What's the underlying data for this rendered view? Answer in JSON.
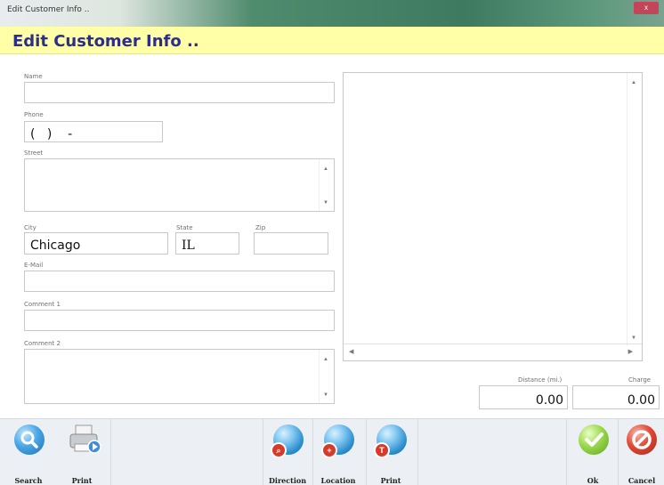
{
  "window": {
    "title": "Edit Customer Info ..",
    "close_label": "x"
  },
  "header": {
    "title": "Edit Customer Info .."
  },
  "form": {
    "name": {
      "label": "Name",
      "value": ""
    },
    "phone": {
      "label": "Phone",
      "value": "(   )    -"
    },
    "street": {
      "label": "Street",
      "value": ""
    },
    "city": {
      "label": "City",
      "value": "Chicago"
    },
    "state": {
      "label": "State",
      "value": "IL"
    },
    "zip": {
      "label": "Zip",
      "value": ""
    },
    "email": {
      "label": "E-Mail",
      "value": ""
    },
    "comment1": {
      "label": "Comment 1",
      "value": ""
    },
    "comment2": {
      "label": "Comment 2",
      "value": ""
    }
  },
  "distance": {
    "label": "Distance (mi.)",
    "value": "0.00"
  },
  "charge": {
    "label": "Charge",
    "value": "0.00"
  },
  "toolbar": {
    "search": "Search",
    "print1": "Print",
    "direction": "Direction",
    "location": "Location",
    "print2": "Print",
    "ok": "Ok",
    "cancel": "Cancel"
  },
  "colors": {
    "header_bg": "#ffffa8",
    "header_text": "#2d2d8a"
  }
}
